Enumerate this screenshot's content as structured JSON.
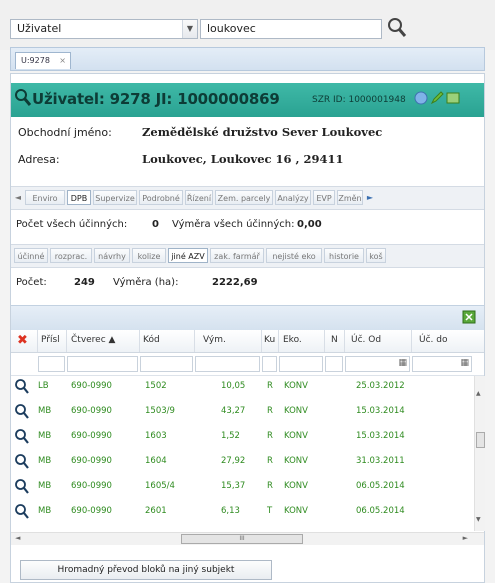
{
  "search": {
    "type_value": "Uživatel",
    "query_value": "loukovec"
  },
  "tabs": [
    {
      "label": "U:9278"
    }
  ],
  "header": {
    "title": "Uživatel: 9278 JI: 1000000869",
    "szr": "SZR ID: 1000001948"
  },
  "info": {
    "obchodni_label": "Obchodní jméno:",
    "obchodni_value": "Zemědělské družstvo Sever Loukovec",
    "adresa_label": "Adresa:",
    "adresa_value": "Loukovec, Loukovec 16 , 29411"
  },
  "subtabs1": [
    "Enviro",
    "DPB",
    "Supervize",
    "Podrobné",
    "Řízení",
    "Zem. parcely",
    "Analýzy",
    "EVP",
    "Změn"
  ],
  "summary1": {
    "count_label": "Počet všech účinných:",
    "count_value": "0",
    "area_label": "Výměra všech účinných:",
    "area_value": "0,00"
  },
  "subtabs2": [
    "účinné",
    "rozprac.",
    "návrhy",
    "kolize",
    "jiné AZV",
    "zak. farmář",
    "nejisté eko",
    "historie",
    "koš"
  ],
  "summary2": {
    "count_label": "Počet:",
    "count_value": "249",
    "area_label": "Výměra (ha):",
    "area_value": "2222,69"
  },
  "grid": {
    "columns": [
      "Přísl",
      "Čtverec ▲",
      "Kód",
      "Vým.",
      "Ku",
      "Eko.",
      "N",
      "Úč. Od",
      "Úč. do"
    ],
    "rows": [
      {
        "p": "LB",
        "ctverec": "690-0990",
        "kod": "1502",
        "vym": "10,05",
        "ku": "R",
        "eko": "KONV",
        "od": "25.03.2012"
      },
      {
        "p": "MB",
        "ctverec": "690-0990",
        "kod": "1503/9",
        "vym": "43,27",
        "ku": "R",
        "eko": "KONV",
        "od": "15.03.2014"
      },
      {
        "p": "MB",
        "ctverec": "690-0990",
        "kod": "1603",
        "vym": "1,52",
        "ku": "R",
        "eko": "KONV",
        "od": "15.03.2014"
      },
      {
        "p": "MB",
        "ctverec": "690-0990",
        "kod": "1604",
        "vym": "27,92",
        "ku": "R",
        "eko": "KONV",
        "od": "31.03.2011"
      },
      {
        "p": "MB",
        "ctverec": "690-0990",
        "kod": "1605/4",
        "vym": "15,37",
        "ku": "R",
        "eko": "KONV",
        "od": "06.05.2014"
      },
      {
        "p": "MB",
        "ctverec": "690-0990",
        "kod": "2601",
        "vym": "6,13",
        "ku": "T",
        "eko": "KONV",
        "od": "06.05.2014"
      }
    ],
    "scroll_glyph": "III"
  },
  "footer": {
    "button_label": "Hromadný převod bloků na jiný subjekt"
  },
  "colors": {
    "header": "#2aa292",
    "data_text": "#2e8b1f",
    "tab_bg": "#d3e1f0"
  }
}
